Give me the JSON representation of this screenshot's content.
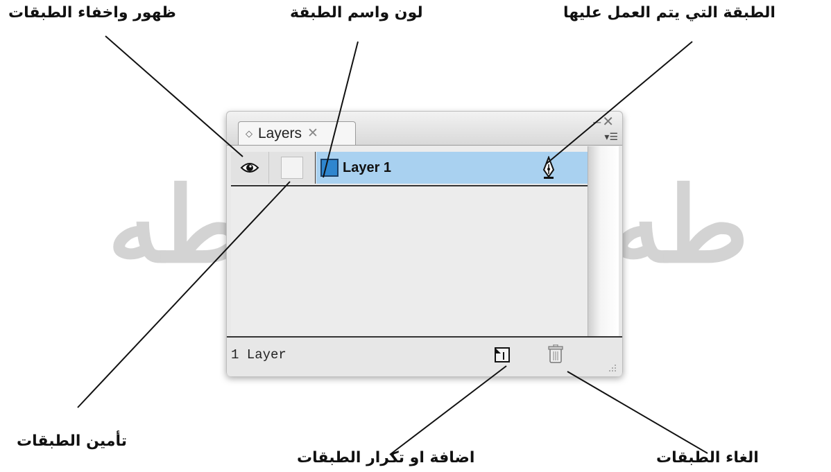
{
  "callouts": {
    "visibility": "ظهور واخفاء الطبقات",
    "color_name": "لون واسم الطبقة",
    "active_layer": "الطبقة التي يتم العمل عليها",
    "lock": "تأمين الطبقات",
    "add_duplicate": "اضافة او تكرار الطبقات",
    "delete": "الغاء الطبقات"
  },
  "watermark": "طه",
  "panel": {
    "tab_label": "Layers",
    "tab_close_glyph": "✕",
    "window_buttons": "–✕",
    "menu_glyph": "▾☰",
    "layers": [
      {
        "name": "Layer 1",
        "color": "#2f86cf",
        "visible": true,
        "locked": false,
        "selected": true
      }
    ],
    "footer_count": "1 Layer"
  },
  "colors": {
    "selection": "#a9d1f0",
    "layer_swatch": "#2f86cf",
    "watermark": "#d3d3d3"
  }
}
